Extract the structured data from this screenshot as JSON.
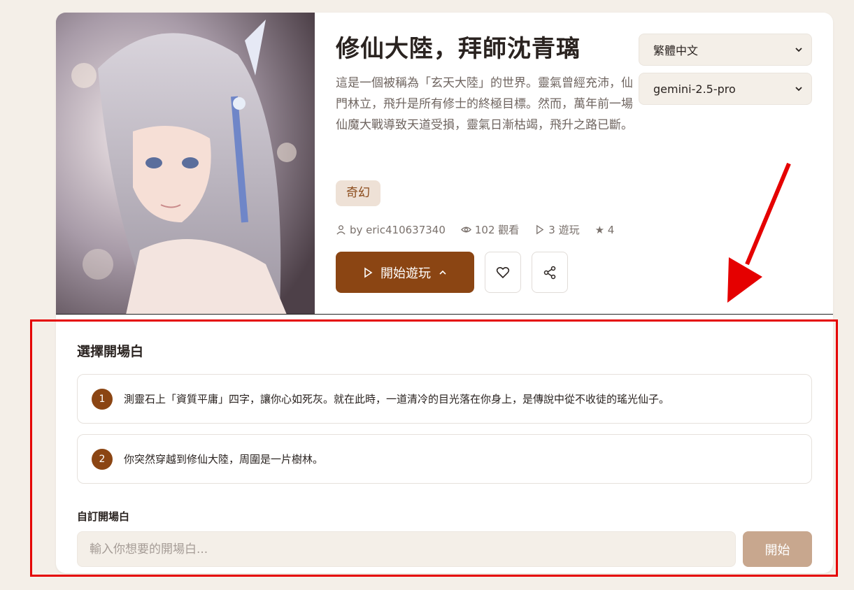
{
  "story": {
    "title": "修仙大陸，拜師沈青璃",
    "description": "這是一個被稱為「玄天大陸」的世界。靈氣曾經充沛，仙門林立，飛升是所有修士的終極目標。然而，萬年前一場仙魔大戰導致天道受損，靈氣日漸枯竭，飛升之路已斷。",
    "tag": "奇幻",
    "meta": {
      "author": "by eric410637340",
      "views": "102 觀看",
      "plays": "3 遊玩",
      "rating": "★ 4"
    }
  },
  "actions": {
    "play_label": "開始遊玩"
  },
  "settings": {
    "language": "繁體中文",
    "model": "gemini-2.5-pro"
  },
  "openers": {
    "title": "選擇開場白",
    "items": [
      {
        "num": "1",
        "text": "測靈石上「資質平庸」四字，讓你心如死灰。就在此時，一道清冷的目光落在你身上，是傳說中從不收徒的瑤光仙子。"
      },
      {
        "num": "2",
        "text": "你突然穿越到修仙大陸，周圍是一片樹林。"
      }
    ],
    "custom_label": "自訂開場白",
    "custom_placeholder": "輸入你想要的開場白...",
    "start_label": "開始"
  },
  "colors": {
    "accent": "#8b4513",
    "background": "#f4efe8",
    "annotation": "#e50000"
  }
}
